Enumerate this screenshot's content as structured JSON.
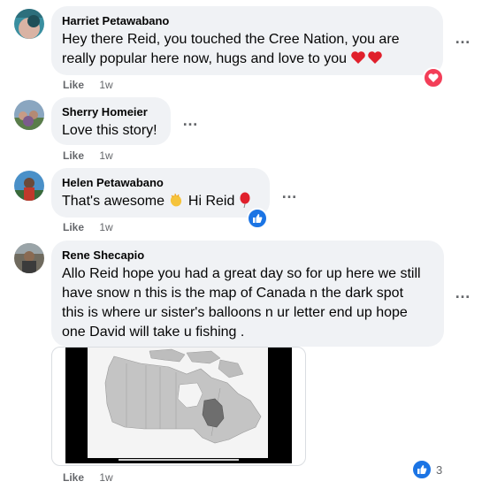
{
  "comments": [
    {
      "author": "Harriet Petawabano",
      "lines": [
        "Hey there Reid, you touched the Cree Nation, you are",
        "really popular here now, hugs and love to you"
      ],
      "like": "Like",
      "time": "1w",
      "reaction": "heart"
    },
    {
      "author": "Sherry Homeier",
      "lines": [
        "Love this story!"
      ],
      "like": "Like",
      "time": "1w"
    },
    {
      "author": "Helen Petawabano",
      "lines": [
        "That's awesome",
        "Hi Reid"
      ],
      "like": "Like",
      "time": "1w",
      "reaction": "like"
    },
    {
      "author": "Rene Shecapio",
      "lines": [
        "Allo Reid hope you had a great day so for up here we still",
        "have snow n this is the map of Canada n the dark spot",
        "this is where ur sister's balloons n ur letter end up hope",
        "one David will take u fishing ."
      ],
      "like": "Like",
      "time": "1w",
      "reaction": "like",
      "reaction_count": "3"
    }
  ],
  "more_label": "…",
  "colors": {
    "bubble": "#f0f2f5",
    "like_blue": "#1b74e4",
    "heart_red": "#f33e58",
    "secondary_text": "#65676b"
  }
}
